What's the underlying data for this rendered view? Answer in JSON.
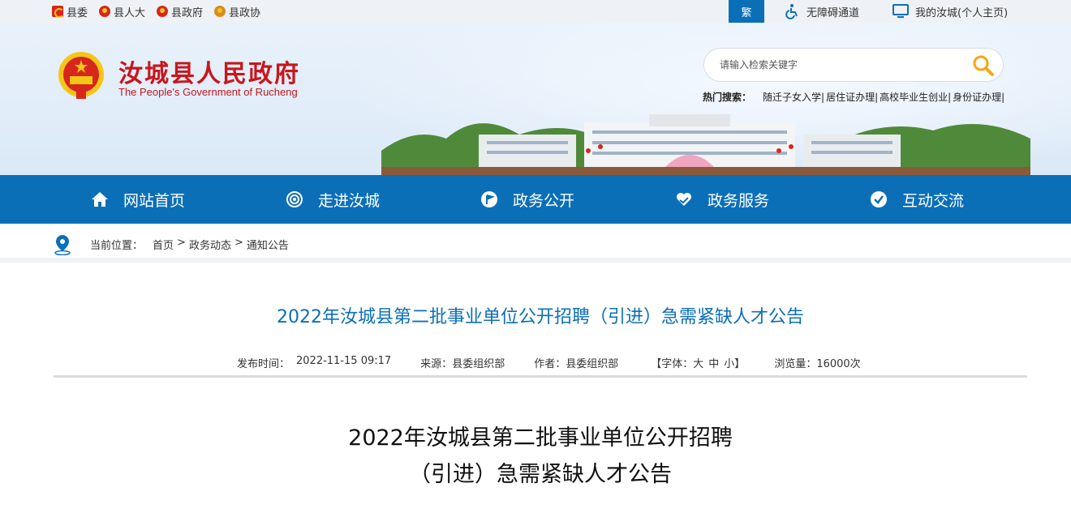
{
  "topbar": {
    "links": [
      {
        "label": "县委",
        "icon": "party-emblem-icon"
      },
      {
        "label": "县人大",
        "icon": "national-emblem-icon"
      },
      {
        "label": "县政府",
        "icon": "national-emblem-icon"
      },
      {
        "label": "县政协",
        "icon": "cppcc-emblem-icon"
      }
    ],
    "traditional_label": "繁",
    "accessibility_label": "无障碍通道",
    "homepage_label": "我的汝城(个人主页)",
    "accent": "#0b6fb8"
  },
  "header": {
    "title": "汝城县人民政府",
    "subtitle": "The People's Government of Rucheng",
    "title_color": "#c8161d"
  },
  "search": {
    "placeholder": "请输入检索关键字",
    "hot_label": "热门搜索：",
    "hot_keywords": [
      "随迁子女入学|",
      "居住证办理|",
      "高校毕业生创业|",
      "身份证办理|"
    ]
  },
  "nav": {
    "items": [
      {
        "label": "网站首页",
        "icon": "home-icon"
      },
      {
        "label": "走进汝城",
        "icon": "target-icon"
      },
      {
        "label": "政务公开",
        "icon": "flag-icon"
      },
      {
        "label": "政务服务",
        "icon": "heart-hand-icon"
      },
      {
        "label": "互动交流",
        "icon": "check-circle-icon"
      }
    ],
    "background": "#0b6fb8"
  },
  "breadcrumb": {
    "label": "当前位置：",
    "items": [
      "首页",
      "政务动态",
      "通知公告"
    ],
    "separator": ">"
  },
  "article": {
    "title": "2022年汝城县第二批事业单位公开招聘（引进）急需紧缺人才公告",
    "publish_label": "发布时间：",
    "publish_time": "2022-11-15 09:17",
    "source_label": "来源：",
    "source": "县委组织部",
    "author_label": "作者：",
    "author": "县委组织部",
    "fontsize_label": "【字体：",
    "fontsize_large": "大",
    "fontsize_medium": "中",
    "fontsize_small": "小",
    "fontsize_end": "】",
    "views_label": "浏览量：",
    "views": "16000次",
    "body_title_line1": "2022年汝城县第二批事业单位公开招聘",
    "body_title_line2": "（引进）急需紧缺人才公告"
  }
}
